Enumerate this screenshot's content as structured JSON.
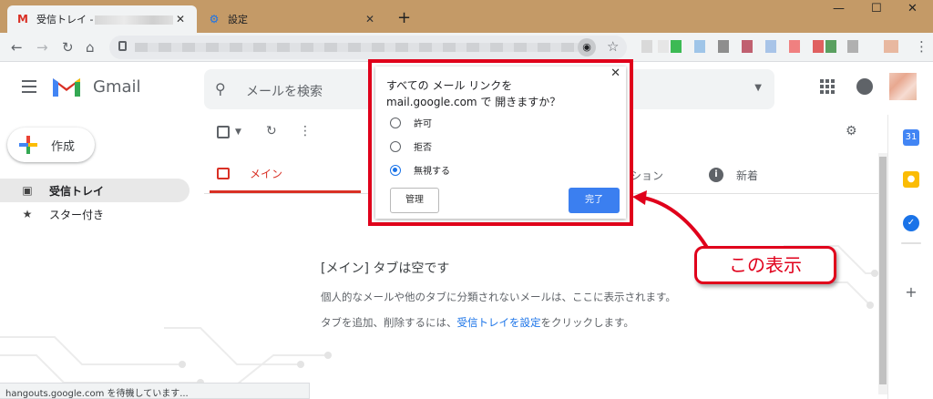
{
  "browser": {
    "tabs": [
      {
        "label": "受信トレイ -",
        "favicon": "gmail-icon",
        "active": true
      },
      {
        "label": "設定",
        "favicon": "gear-icon",
        "active": false
      }
    ],
    "close_glyph": "✕",
    "newtab_glyph": "+",
    "window_controls": [
      "—",
      "☐",
      "✕"
    ]
  },
  "gmail": {
    "logo_text": "Gmail",
    "search_placeholder": "メールを検索",
    "compose_label": "作成",
    "sidebar": [
      {
        "label": "受信トレイ",
        "icon": "inbox-icon",
        "active": true
      },
      {
        "label": "スター付き",
        "icon": "star-icon",
        "active": false
      }
    ],
    "categories": [
      {
        "label": "メイン",
        "icon": "inbox-icon",
        "active": true
      },
      {
        "label": "ション",
        "icon": "",
        "active": false
      },
      {
        "label": "新着",
        "icon": "info-icon",
        "active": false
      }
    ],
    "empty_title": "[メイン] タブは空です",
    "empty_line1": "個人的なメールや他のタブに分類されないメールは、ここに表示されます。",
    "empty_line2_pre": "タブを追加、削除するには、",
    "empty_line2_link": "受信トレイを設定",
    "empty_line2_post": "をクリックします。"
  },
  "dialog": {
    "message": "すべての メール リンクを mail.google.com で 開きますか？",
    "options": [
      {
        "label": "許可",
        "selected": false
      },
      {
        "label": "拒否",
        "selected": false
      },
      {
        "label": "無視する",
        "selected": true
      }
    ],
    "manage_label": "管理",
    "done_label": "完了",
    "close_glyph": "✕"
  },
  "annotation": {
    "label": "この表示",
    "color": "#e0001b"
  },
  "status_text": "hangouts.google.com を待機しています...",
  "colors": {
    "accent_red": "#d93025",
    "link_blue": "#1a73e8",
    "titlebar": "#c49a67"
  }
}
